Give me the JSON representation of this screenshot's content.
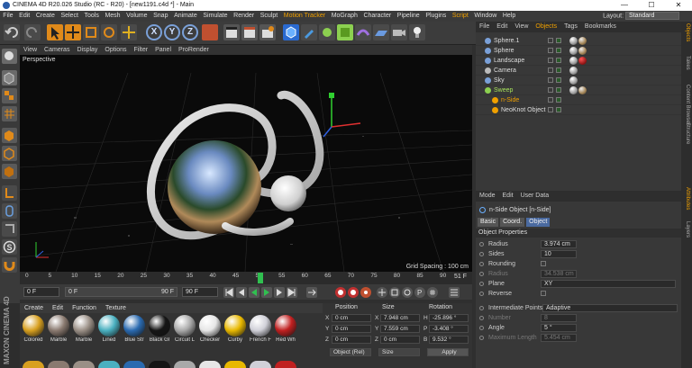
{
  "titlebar": {
    "title": "CINEMA 4D R20.026 Studio (RC - R20) - [new1191.c4d *] - Main",
    "minimize": "—",
    "maximize": "☐",
    "close": "✕"
  },
  "menubar": {
    "items": [
      "File",
      "Edit",
      "Create",
      "Select",
      "Tools",
      "Mesh",
      "Volume",
      "Snap",
      "Animate",
      "Simulate",
      "Render",
      "Sculpt",
      "Motion Tracker",
      "MoGraph",
      "Character",
      "Pipeline",
      "Plugins",
      "Script",
      "Window",
      "Help"
    ],
    "highlighted": [
      "Motion Tracker",
      "Script"
    ],
    "layout_label": "Layout:",
    "layout_value": "Standard"
  },
  "toolbar": {
    "axis_buttons": [
      "X",
      "Y",
      "Z"
    ]
  },
  "viewport_menu": {
    "items": [
      "View",
      "Cameras",
      "Display",
      "Options",
      "Filter",
      "Panel",
      "ProRender"
    ]
  },
  "viewport": {
    "label": "Perspective",
    "grid_spacing": "Grid Spacing : 100 cm"
  },
  "timeline": {
    "ticks": [
      "0",
      "5",
      "10",
      "15",
      "20",
      "25",
      "30",
      "35",
      "40",
      "45",
      "50",
      "55",
      "60",
      "65",
      "70",
      "75",
      "80",
      "85",
      "90"
    ],
    "current_frame": 51,
    "end_label": "51 F"
  },
  "playback": {
    "start": "0 F",
    "range_start": "0 F",
    "range_end": "90 F",
    "end": "90 F"
  },
  "materials": {
    "tabs": [
      "Create",
      "Edit",
      "Function",
      "Texture"
    ],
    "items": [
      {
        "name": "Colored",
        "color": "#d8a020"
      },
      {
        "name": "Marble",
        "color": "#8a7a70"
      },
      {
        "name": "Marble",
        "color": "#9a8f86"
      },
      {
        "name": "Lined",
        "color": "#4ab0c0"
      },
      {
        "name": "Blue Str",
        "color": "#2a6ab0"
      },
      {
        "name": "Black Gl",
        "color": "#151515"
      },
      {
        "name": "Circuit L",
        "color": "#a9a9a9"
      },
      {
        "name": "Checker",
        "color": "#e6e6e6"
      },
      {
        "name": "Curby",
        "color": "#e8b800"
      },
      {
        "name": "French F",
        "color": "#d0d0d8"
      },
      {
        "name": "Red Wh",
        "color": "#c02020"
      }
    ]
  },
  "logo": {
    "text": "MAXON CINEMA 4D"
  },
  "coordinates": {
    "headers": {
      "position": "Position",
      "size": "Size",
      "rotation": "Rotation"
    },
    "rows": [
      {
        "axis": "X",
        "pos": "0 cm",
        "size_axis": "X",
        "size": "7.948 cm",
        "rot_axis": "H",
        "rot": "-25.896 °"
      },
      {
        "axis": "Y",
        "pos": "0 cm",
        "size_axis": "Y",
        "size": "7.559 cm",
        "rot_axis": "P",
        "rot": "-3.408 °"
      },
      {
        "axis": "Z",
        "pos": "0 cm",
        "size_axis": "Z",
        "size": "0 cm",
        "rot_axis": "B",
        "rot": "9.532 °"
      }
    ],
    "mode": "Object (Rel)",
    "size_mode": "Size",
    "apply": "Apply"
  },
  "objects_panel": {
    "tabs": [
      "File",
      "Edit",
      "View",
      "Objects",
      "Tags",
      "Bookmarks"
    ],
    "active_tab": "Objects",
    "rows": [
      {
        "name": "Sphere.1",
        "color": "#7aa0d8"
      },
      {
        "name": "Sphere",
        "color": "#7aa0d8"
      },
      {
        "name": "Landscape",
        "color": "#7aa0d8"
      },
      {
        "name": "Camera",
        "color": "#bbbbbb"
      },
      {
        "name": "Sky",
        "color": "#7aa0d8"
      },
      {
        "name": "Sweep",
        "color": "#8cd050",
        "highlight": "#a6e05a"
      },
      {
        "name": "n-Side",
        "color": "#f0a000",
        "highlight": "#f0a000"
      },
      {
        "name": "NeoKnot Object",
        "color": "#f0a000"
      }
    ]
  },
  "attributes": {
    "menu": [
      "Mode",
      "Edit",
      "User Data"
    ],
    "object_title": "n-Side Object [n-Side]",
    "tabs": [
      "Basic",
      "Coord.",
      "Object"
    ],
    "active_tab": "Object",
    "section": "Object Properties",
    "fields": [
      {
        "label": "Radius",
        "value": "3.974 cm",
        "dim": false
      },
      {
        "label": "Sides",
        "value": "10",
        "dim": false
      },
      {
        "label": "Rounding",
        "value": "",
        "dim": false
      },
      {
        "label": "Radius",
        "value": "34.538 cm",
        "dim": true
      },
      {
        "label": "Plane",
        "value": "XY",
        "dim": false
      },
      {
        "label": "Reverse",
        "value": "",
        "dim": false
      },
      {
        "label": "Intermediate Points",
        "value": "Adaptive",
        "dim": false
      },
      {
        "label": "Number",
        "value": "8",
        "dim": true
      },
      {
        "label": "Angle",
        "value": "5 °",
        "dim": false
      },
      {
        "label": "Maximum Length",
        "value": "5.454 cm",
        "dim": true
      }
    ]
  },
  "right_tabs": [
    "Objects",
    "Takes",
    "Content Browser",
    "Structure",
    "Attributes",
    "Layers"
  ]
}
